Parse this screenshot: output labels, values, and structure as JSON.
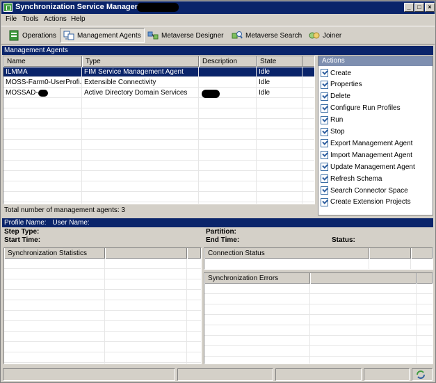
{
  "window": {
    "title": "Synchronization Service Manager on",
    "controls": [
      "_",
      "□",
      "×"
    ]
  },
  "menu": [
    "File",
    "Tools",
    "Actions",
    "Help"
  ],
  "toolbar": [
    {
      "label": "Operations",
      "icon": "operations-icon",
      "active": false
    },
    {
      "label": "Management Agents",
      "icon": "management-agents-icon",
      "active": true
    },
    {
      "label": "Metaverse Designer",
      "icon": "metaverse-designer-icon",
      "active": false
    },
    {
      "label": "Metaverse Search",
      "icon": "metaverse-search-icon",
      "active": false
    },
    {
      "label": "Joiner",
      "icon": "joiner-icon",
      "active": false
    }
  ],
  "ma_section": {
    "title": "Management Agents"
  },
  "ma_grid": {
    "columns": [
      "Name",
      "Type",
      "Description",
      "State"
    ],
    "rows": [
      {
        "name": "ILMMA",
        "type": "FIM Service Management Agent",
        "description": "",
        "state": "Idle",
        "selected": true
      },
      {
        "name": "MOSS-Farm0-UserProfi...",
        "type": "Extensible Connectivity",
        "description": "",
        "state": "Idle",
        "selected": false
      },
      {
        "name": "MOSSAD-",
        "type": "Active Directory Domain Services",
        "description": "",
        "state": "Idle",
        "selected": false
      }
    ]
  },
  "ma_total": "Total number of management agents: 3",
  "actions": {
    "header": "Actions",
    "items": [
      "Create",
      "Properties",
      "Delete",
      "Configure Run Profiles",
      "Run",
      "Stop",
      "Export Management Agent",
      "Import Management Agent",
      "Update Management Agent",
      "Refresh Schema",
      "Search Connector Space",
      "Create Extension Projects"
    ]
  },
  "profile_bar": {
    "profile_label": "Profile Name:",
    "user_label": "User Name:"
  },
  "details": {
    "step_type": "Step Type:",
    "start_time": "Start Time:",
    "partition": "Partition:",
    "end_time": "End Time:",
    "status": "Status:"
  },
  "sync_stats": {
    "header": "Synchronization Statistics"
  },
  "conn_status": {
    "header": "Connection Status"
  },
  "sync_errors": {
    "header": "Synchronization Errors"
  }
}
